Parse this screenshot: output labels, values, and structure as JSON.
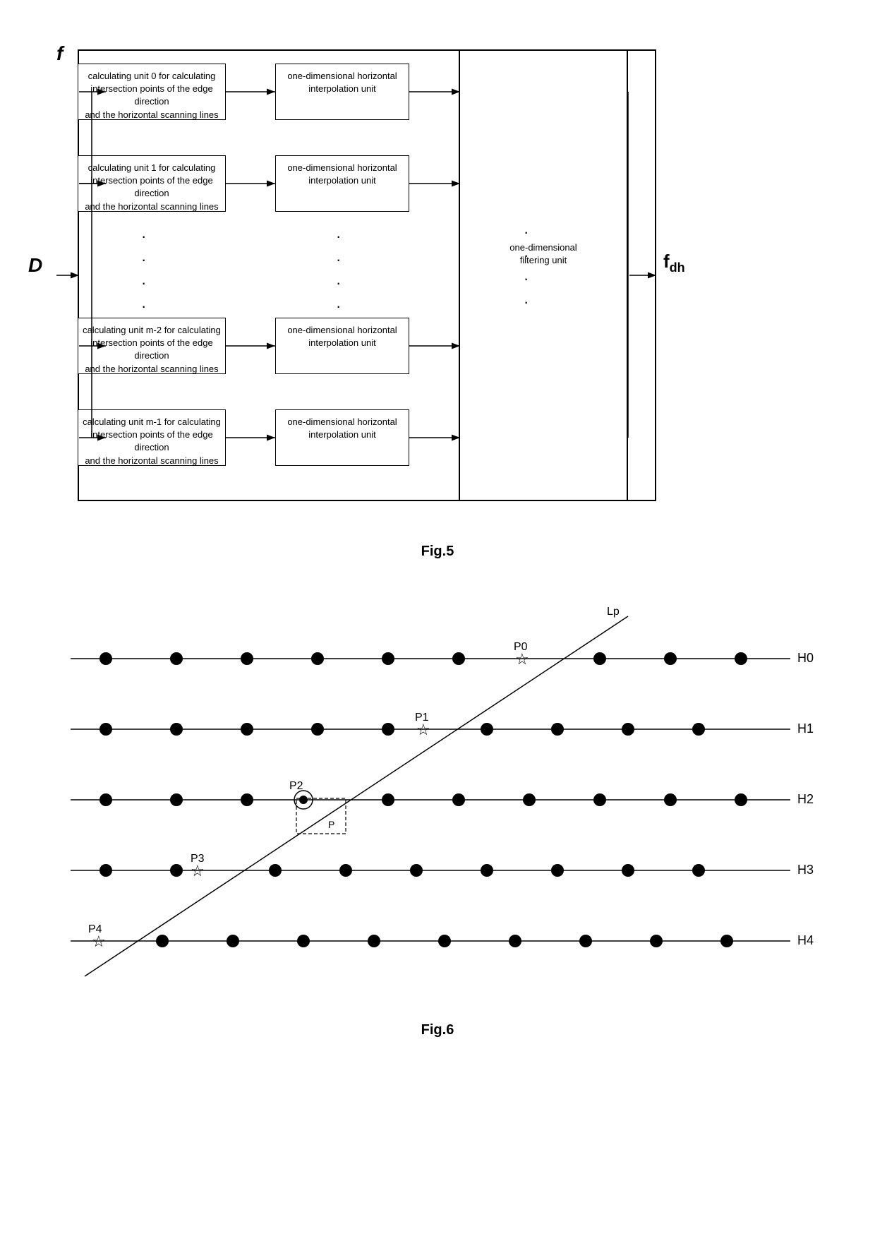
{
  "fig5": {
    "label_f": "f",
    "label_D": "D",
    "label_fdh": "f",
    "label_fdh_sub": "dh",
    "calc_boxes": [
      "calculating unit 0 for calculating\nintersection points of the edge direction\nand the horizontal scanning lines",
      "calculating unit 1 for calculating\nintersection points of the edge direction\nand the horizontal scanning lines",
      "calculating unit m-2 for calculating\nintersection points of the edge direction\nand the horizontal scanning lines",
      "calculating unit m-1 for calculating\nintersection points of the edge direction\nand the horizontal scanning lines"
    ],
    "interp_boxes": [
      "one-dimensional horizontal\ninterpolation unit",
      "one-dimensional horizontal\ninterpolation unit",
      "one-dimensional horizontal\ninterpolation unit",
      "one-dimensional horizontal\ninterpolation unit"
    ],
    "filter_label": "one-dimensional\nfiltering unit",
    "caption": "Fig.5"
  },
  "fig6": {
    "labels": {
      "Lp": "Lp",
      "P0": "P0",
      "P1": "P1",
      "P2": "P2",
      "P3": "P3",
      "P4": "P4",
      "P": "P",
      "H0": "H0",
      "H1": "H1",
      "H2": "H2",
      "H3": "H3",
      "H4": "H4"
    },
    "caption": "Fig.6"
  }
}
